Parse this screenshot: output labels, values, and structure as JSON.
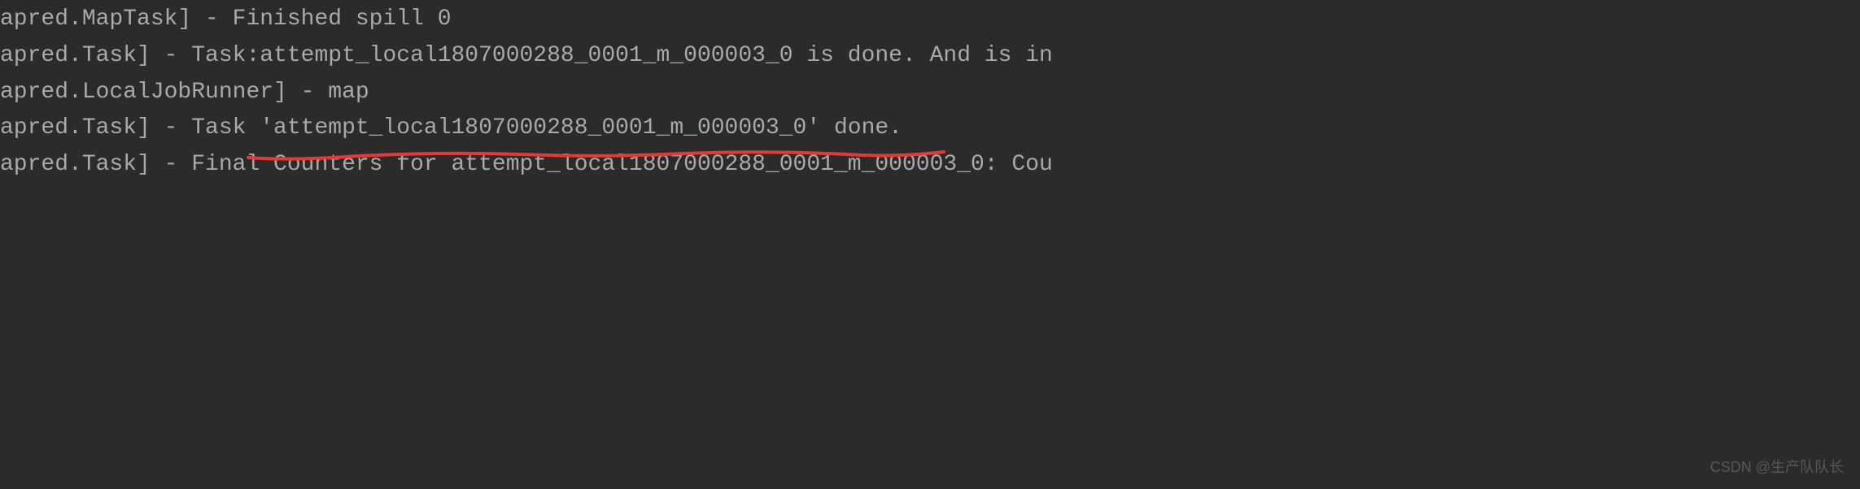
{
  "log": {
    "lines": [
      "apred.MapTask] - Finished spill 0",
      "apred.Task] - Task:attempt_local1807000288_0001_m_000003_0 is done. And is in",
      "apred.LocalJobRunner] - map",
      "apred.Task] - Task 'attempt_local1807000288_0001_m_000003_0' done.",
      "apred.Task] - Final Counters for attempt_local1807000288_0001_m_000003_0: Cou"
    ]
  },
  "annotation": {
    "underline_color": "#e53935",
    "underline_stroke_width": 4
  },
  "watermark": {
    "text": "CSDN @生产队队长"
  }
}
